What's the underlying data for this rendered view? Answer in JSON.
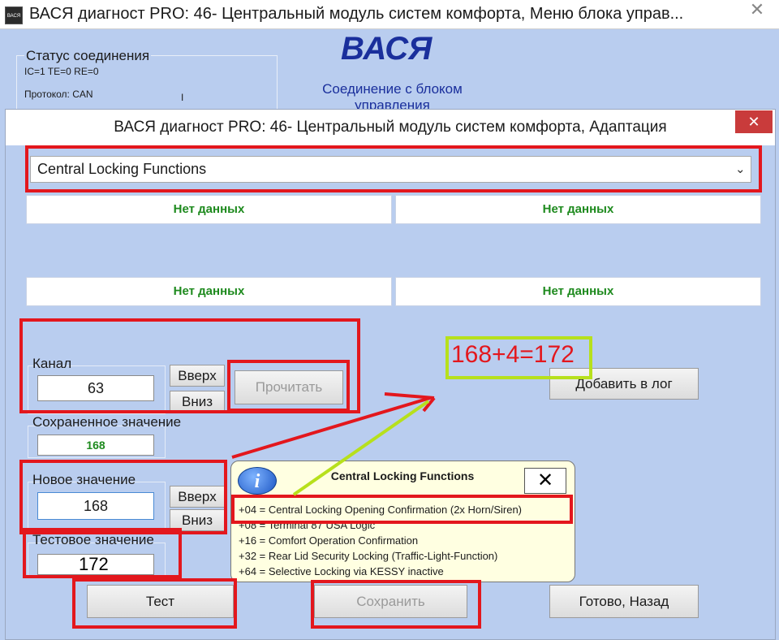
{
  "outer_window": {
    "app_icon_text": "ВАСЯ",
    "title": "ВАСЯ диагност PRO: 46- Центральный модуль систем комфорта,  Меню блока управ...",
    "close_glyph": "✕",
    "status_group_label": "Статус соединения",
    "status_line": "IC=1  TE=0  RE=0",
    "protocol_line": "Протокол: CAN",
    "status_cursor": "I",
    "logo": "ВАСЯ",
    "connection_text": "Соединение с блоком управления"
  },
  "dialog": {
    "title": "ВАСЯ диагност PRO: 46- Центральный модуль систем комфорта, Адаптация",
    "close_glyph": "✕",
    "dropdown": {
      "selected": "Central Locking Functions",
      "icon": "chevron-down-icon"
    },
    "data_boxes": [
      "Нет данных",
      "Нет данных",
      "Нет данных",
      "Нет данных"
    ],
    "channel": {
      "label": "Канал",
      "value": "63",
      "up_label": "Вверх",
      "down_label": "Вниз",
      "read_label": "Прочитать"
    },
    "saved": {
      "label": "Сохраненное значение",
      "value": "168"
    },
    "new_value": {
      "label": "Новое значение",
      "value": "168",
      "up_label": "Вверх",
      "down_label": "Вниз"
    },
    "test_value": {
      "label": "Тестовое значение",
      "value": "172"
    },
    "buttons": {
      "add_log": "Добавить в лог",
      "test": "Тест",
      "save": "Сохранить",
      "done_back": "Готово, Назад"
    }
  },
  "annotation": {
    "formula": "168+4=172",
    "colors": {
      "red": "#e3171d",
      "green": "#b7e01c"
    }
  },
  "tooltip": {
    "icon": "info-icon",
    "icon_glyph": "i",
    "title": "Central Locking Functions",
    "close_glyph": "✕",
    "lines": [
      "+04 = Central Locking Opening Confirmation (2x Horn/Siren)",
      "+08 = Terminal 87 USA Logic",
      "+16 = Comfort Operation Confirmation",
      "+32 = Rear Lid Security Locking (Traffic-Light-Function)",
      "+64 = Selective Locking via KESSY inactive"
    ]
  }
}
